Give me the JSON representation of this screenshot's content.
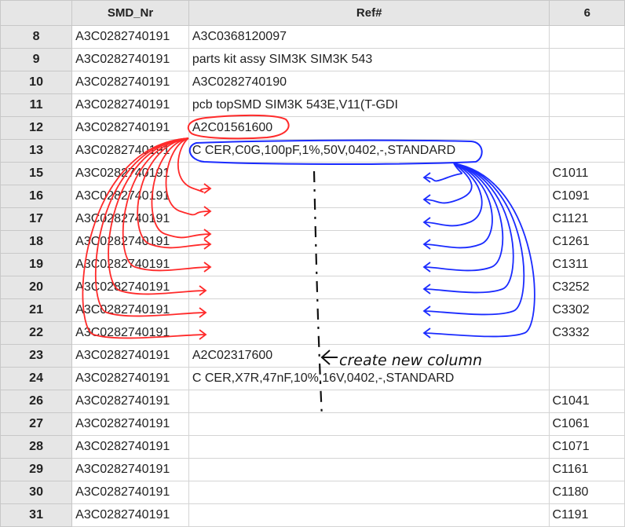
{
  "columns": [
    "SMD_Nr",
    "Ref#",
    "6"
  ],
  "rows": [
    {
      "num": "8",
      "smd": "A3C0282740191",
      "ref": "A3C0368120097",
      "c6": ""
    },
    {
      "num": "9",
      "smd": "A3C0282740191",
      "ref": "parts kit assy SIM3K SIM3K 543",
      "c6": ""
    },
    {
      "num": "10",
      "smd": "A3C0282740191",
      "ref": "A3C0282740190",
      "c6": ""
    },
    {
      "num": "11",
      "smd": "A3C0282740191",
      "ref": "pcb topSMD SIM3K 543E,V11(T-GDI",
      "c6": ""
    },
    {
      "num": "12",
      "smd": "A3C0282740191",
      "ref": "A2C01561600",
      "c6": ""
    },
    {
      "num": "13",
      "smd": "A3C0282740191",
      "ref": "C CER,C0G,100pF,1%,50V,0402,-,STANDARD",
      "c6": ""
    },
    {
      "num": "15",
      "smd": "A3C0282740191",
      "ref": "",
      "c6": "C1011"
    },
    {
      "num": "16",
      "smd": "A3C0282740191",
      "ref": "",
      "c6": "C1091"
    },
    {
      "num": "17",
      "smd": "A3C0282740191",
      "ref": "",
      "c6": "C1121"
    },
    {
      "num": "18",
      "smd": "A3C0282740191",
      "ref": "",
      "c6": "C1261"
    },
    {
      "num": "19",
      "smd": "A3C0282740191",
      "ref": "",
      "c6": "C1311"
    },
    {
      "num": "20",
      "smd": "A3C0282740191",
      "ref": "",
      "c6": "C3252"
    },
    {
      "num": "21",
      "smd": "A3C0282740191",
      "ref": "",
      "c6": "C3302"
    },
    {
      "num": "22",
      "smd": "A3C0282740191",
      "ref": "",
      "c6": "C3332"
    },
    {
      "num": "23",
      "smd": "A3C0282740191",
      "ref": "A2C02317600",
      "c6": ""
    },
    {
      "num": "24",
      "smd": "A3C0282740191",
      "ref": "C CER,X7R,47nF,10%,16V,0402,-,STANDARD",
      "c6": ""
    },
    {
      "num": "26",
      "smd": "A3C0282740191",
      "ref": "",
      "c6": "C1041"
    },
    {
      "num": "27",
      "smd": "A3C0282740191",
      "ref": "",
      "c6": "C1061"
    },
    {
      "num": "28",
      "smd": "A3C0282740191",
      "ref": "",
      "c6": "C1071"
    },
    {
      "num": "29",
      "smd": "A3C0282740191",
      "ref": "",
      "c6": "C1161"
    },
    {
      "num": "30",
      "smd": "A3C0282740191",
      "ref": "",
      "c6": "C1180"
    },
    {
      "num": "31",
      "smd": "A3C0282740191",
      "ref": "",
      "c6": "C1191"
    }
  ],
  "annotation": {
    "note": "create new column",
    "colors": {
      "red": "#ff2a2a",
      "blue": "#1a2bff",
      "black": "#111111"
    }
  }
}
